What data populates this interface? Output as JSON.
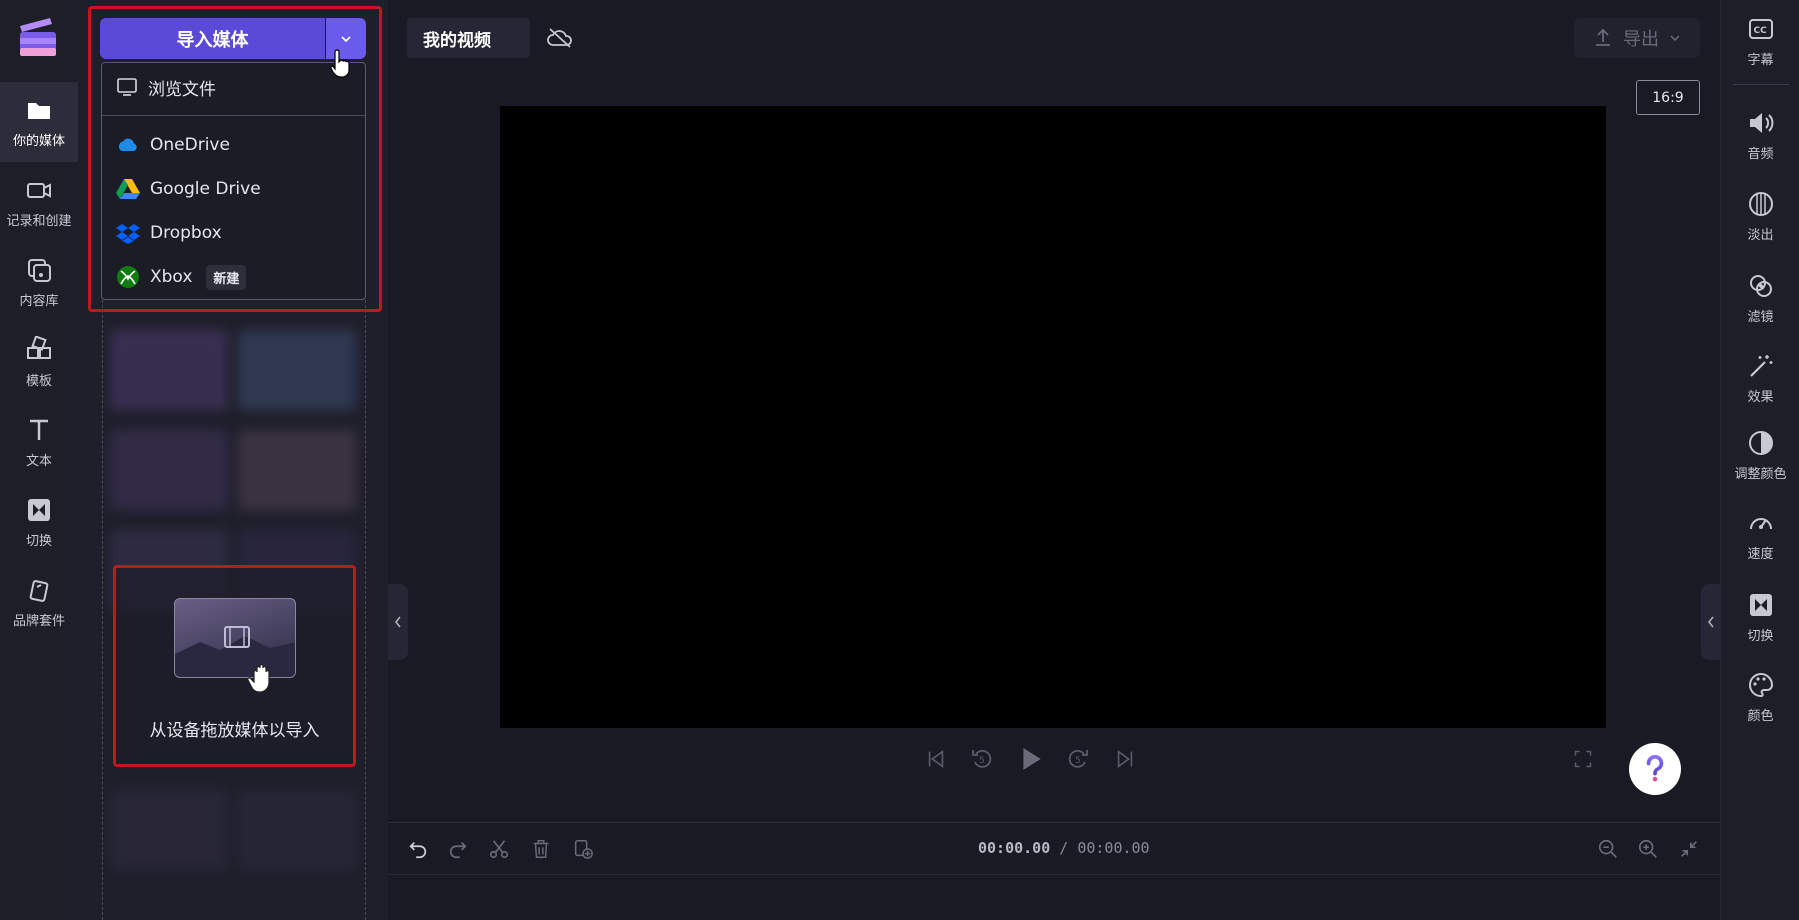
{
  "left_nav": {
    "items": [
      {
        "label": "你的媒体",
        "icon": "folder-icon",
        "active": true
      },
      {
        "label": "记录和创建",
        "icon": "video-camera-icon"
      },
      {
        "label": "内容库",
        "icon": "content-library-icon"
      },
      {
        "label": "模板",
        "icon": "templates-icon"
      },
      {
        "label": "文本",
        "icon": "text-icon"
      },
      {
        "label": "切换",
        "icon": "transitions-icon"
      },
      {
        "label": "品牌套件",
        "icon": "brand-kit-icon"
      }
    ]
  },
  "media_panel": {
    "import_label": "导入媒体",
    "dropdown": {
      "browse_label": "浏览文件",
      "items": [
        {
          "label": "OneDrive",
          "icon": "onedrive-icon"
        },
        {
          "label": "Google Drive",
          "icon": "google-drive-icon"
        },
        {
          "label": "Dropbox",
          "icon": "dropbox-icon"
        },
        {
          "label": "Xbox",
          "icon": "xbox-icon",
          "badge": "新建"
        }
      ]
    },
    "drop_zone_text": "从设备拖放媒体以导入"
  },
  "header": {
    "project_title": "我的视频",
    "export_label": "导出",
    "aspect_ratio": "16:9"
  },
  "timeline": {
    "current_time": "00:00.00",
    "separator": " / ",
    "total_time": "00:00.00"
  },
  "right_nav": {
    "items": [
      {
        "label": "字幕",
        "icon": "captions-icon"
      },
      {
        "label": "音频",
        "icon": "audio-icon"
      },
      {
        "label": "淡出",
        "icon": "fade-icon"
      },
      {
        "label": "滤镜",
        "icon": "filters-icon"
      },
      {
        "label": "效果",
        "icon": "effects-icon"
      },
      {
        "label": "调整颜色",
        "icon": "adjust-colors-icon"
      },
      {
        "label": "速度",
        "icon": "speed-icon"
      },
      {
        "label": "切换",
        "icon": "transition-icon"
      },
      {
        "label": "颜色",
        "icon": "color-palette-icon"
      }
    ]
  },
  "colors": {
    "accent": "#5b4ad8",
    "highlight_border": "#c4161c",
    "background": "#1a1a24"
  }
}
